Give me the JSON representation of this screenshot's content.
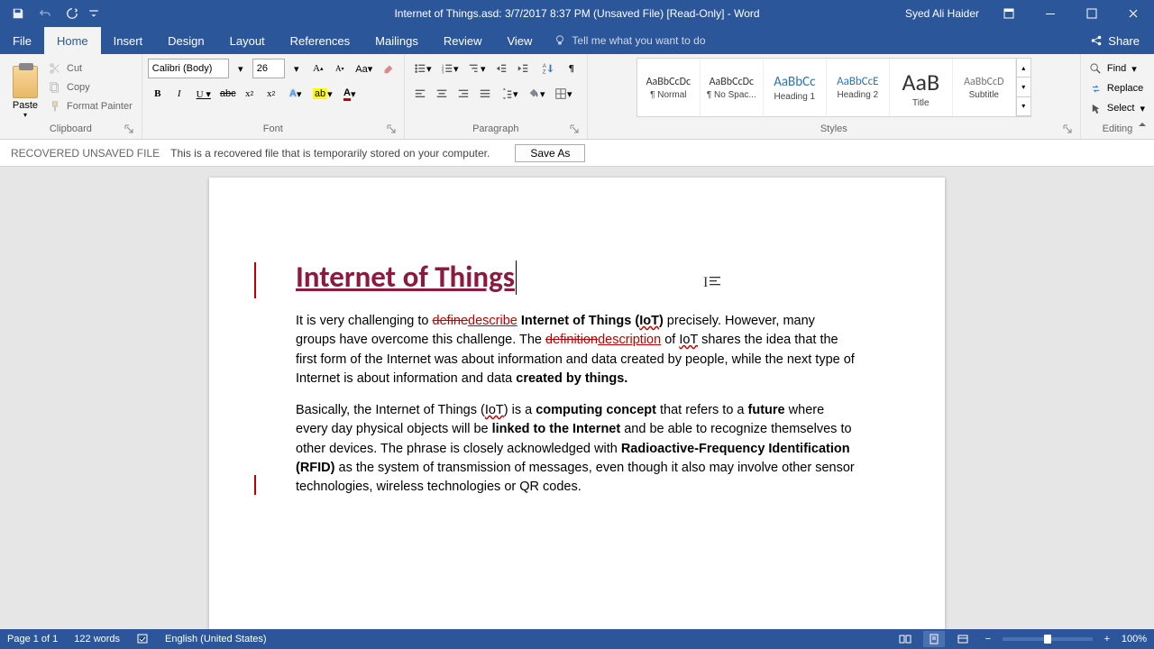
{
  "titlebar": {
    "title": "Internet of Things.asd: 3/7/2017 8:37 PM (Unsaved File) [Read-Only] - Word",
    "user": "Syed Ali Haider"
  },
  "tabs": {
    "file": "File",
    "home": "Home",
    "insert": "Insert",
    "design": "Design",
    "layout": "Layout",
    "references": "References",
    "mailings": "Mailings",
    "review": "Review",
    "view": "View",
    "tellme": "Tell me what you want to do",
    "share": "Share"
  },
  "ribbon": {
    "clipboard": {
      "label": "Clipboard",
      "paste": "Paste",
      "cut": "Cut",
      "copy": "Copy",
      "format_painter": "Format Painter"
    },
    "font": {
      "label": "Font",
      "name": "Calibri (Body)",
      "size": "26"
    },
    "paragraph": {
      "label": "Paragraph"
    },
    "styles": {
      "label": "Styles",
      "items": [
        {
          "preview": "AaBbCcDc",
          "name": "¶ Normal",
          "css": "font-size:12px;color:#333"
        },
        {
          "preview": "AaBbCcDc",
          "name": "¶ No Spac...",
          "css": "font-size:12px;color:#333"
        },
        {
          "preview": "AaBbCc",
          "name": "Heading 1",
          "css": "font-size:15px;color:#2e74b5"
        },
        {
          "preview": "AaBbCcE",
          "name": "Heading 2",
          "css": "font-size:13px;color:#2e74b5"
        },
        {
          "preview": "AaB",
          "name": "Title",
          "css": "font-size:26px;color:#333"
        },
        {
          "preview": "AaBbCcD",
          "name": "Subtitle",
          "css": "font-size:12px;color:#767171"
        }
      ]
    },
    "editing": {
      "label": "Editing",
      "find": "Find",
      "replace": "Replace",
      "select": "Select"
    }
  },
  "recover": {
    "label": "RECOVERED UNSAVED FILE",
    "msg": "This is a recovered file that is temporarily stored on your computer.",
    "save_as": "Save As"
  },
  "document": {
    "heading": "Internet of Things",
    "p1_parts": {
      "t1": "It is very challenging to ",
      "strike1": "define",
      "ins1": "describe",
      "t2": " ",
      "b1": "Internet of Things (",
      "sq1": "IoT",
      "b1b": ")",
      "t3": " precisely. However, many groups have overcome this challenge. The ",
      "strike2": "definition",
      "ins2": "description",
      "t4": " of ",
      "sq2": "IoT",
      "t5": " shares the idea that the first form of the Internet was about information and data created by people, while the next type of Internet is about information and data ",
      "b2": "created by things."
    },
    "p2_parts": {
      "t1": "Basically, the Internet of Things (",
      "sq1": "IoT",
      "t2": ") is a ",
      "b1": "computing concept",
      "t3": " that refers to a ",
      "b2": "future",
      "t4": " where every day physical objects will be ",
      "b3": "linked to the Internet",
      "t5": " and be able to recognize themselves to other devices. The phrase is closely acknowledged with ",
      "b4": "Radioactive-Frequency Identification (RFID)",
      "t6": " as the system of transmission of messages, even though it also may involve other sensor technologies, wireless technologies or QR codes."
    }
  },
  "status": {
    "page": "Page 1 of 1",
    "words": "122 words",
    "lang": "English (United States)",
    "zoom": "100%"
  }
}
